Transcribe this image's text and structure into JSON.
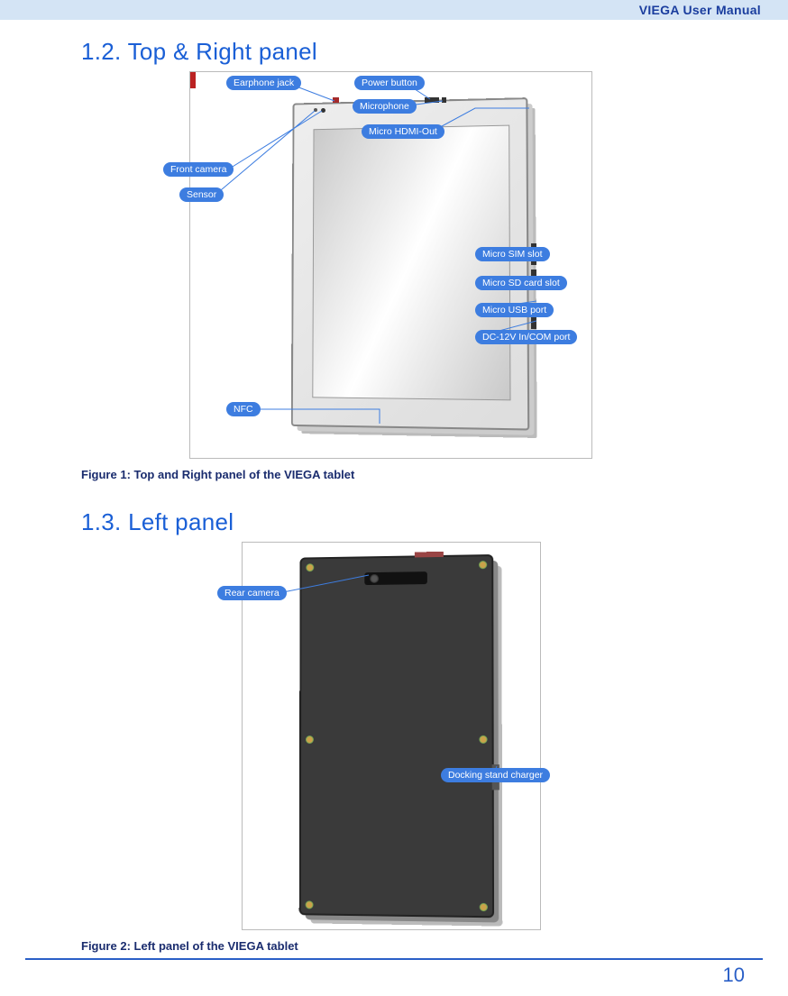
{
  "header": {
    "title": "VIEGA User Manual"
  },
  "sections": {
    "s1": {
      "heading": "1.2. Top & Right panel"
    },
    "s2": {
      "heading": "1.3. Left panel"
    }
  },
  "figures": {
    "f1": {
      "caption": "Figure 1: Top and Right panel of the VIEGA tablet",
      "labels": {
        "earphone": "Earphone jack",
        "power": "Power button",
        "microphone": "Microphone",
        "hdmi": "Micro HDMI-Out",
        "front_camera": "Front camera",
        "sensor": "Sensor",
        "sim": "Micro SIM slot",
        "sd": "Micro SD card slot",
        "usb": "Micro USB port",
        "dc": "DC-12V In/COM port",
        "nfc": "NFC"
      }
    },
    "f2": {
      "caption": "Figure 2: Left panel of the VIEGA tablet",
      "labels": {
        "rear_camera": "Rear camera",
        "dock": "Docking stand charger"
      }
    }
  },
  "page_number": "10"
}
